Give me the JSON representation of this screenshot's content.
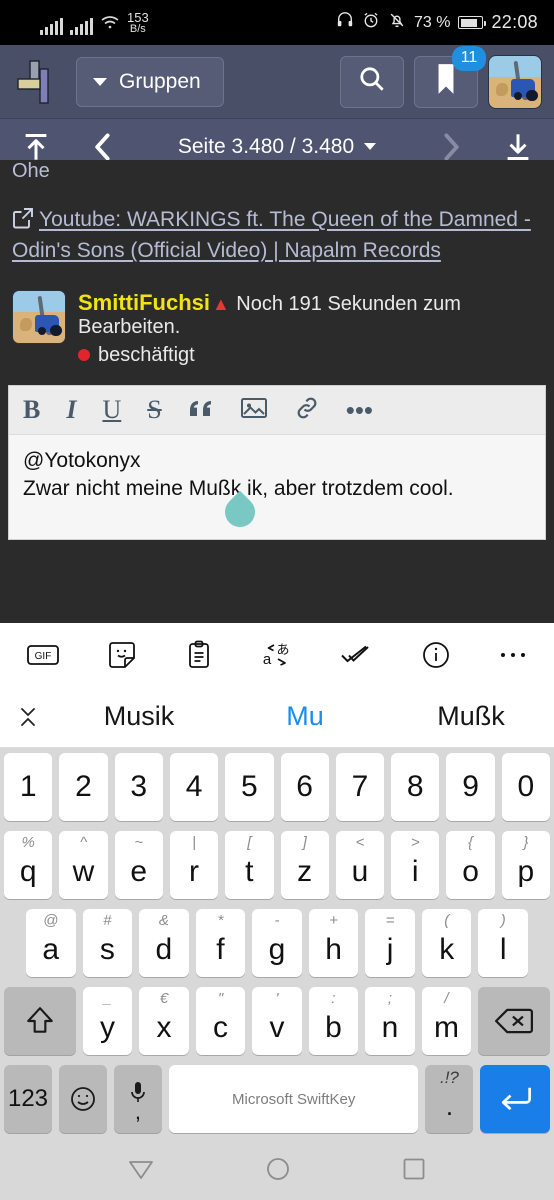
{
  "status_bar": {
    "data_rate_value": "153",
    "data_rate_unit": "B/s",
    "battery_percent": "73 %",
    "clock": "22:08",
    "icons": [
      "signal-bars-icon",
      "signal-bars-icon",
      "wifi-icon",
      "headphones-icon",
      "alarm-icon",
      "mute-bell-icon",
      "battery-icon"
    ]
  },
  "header": {
    "logo": "forum-logo-icon",
    "groups_label": "Gruppen",
    "search_icon": "search-icon",
    "bookmark_icon": "bookmark-icon",
    "bookmark_badge": "11",
    "avatar": "user-avatar-tractor"
  },
  "pagination": {
    "scroll_top_icon": "scroll-to-top-icon",
    "prev_icon": "chevron-left-icon",
    "page_label": "Seite 3.480 / 3.480",
    "dropdown_icon": "chevron-down-icon",
    "next_icon": "chevron-right-icon",
    "scroll_bottom_icon": "scroll-to-bottom-icon"
  },
  "thread": {
    "clipped_text": "Ohe",
    "link_icon": "external-link-icon",
    "link_text": "Youtube: WARKINGS ft. The Queen of the Damned - Odin's Sons (Official Video) | Napalm Records",
    "post": {
      "username": "SmittiFuchsi",
      "warning_icon": "warning-triangle-icon",
      "edit_notice": "Noch 191 Sekunden zum Bearbeiten.",
      "presence_label": "beschäftigt",
      "presence_color": "#e0262b",
      "username_color": "#f2e313"
    }
  },
  "editor": {
    "toolbar": [
      {
        "name": "bold-button",
        "label": "B"
      },
      {
        "name": "italic-button",
        "label": "I"
      },
      {
        "name": "underline-button",
        "label": "U"
      },
      {
        "name": "strikethrough-button",
        "label": "S"
      },
      {
        "name": "quote-button",
        "label": "”"
      },
      {
        "name": "image-button",
        "label": "image-icon"
      },
      {
        "name": "link-button",
        "label": "link-icon"
      },
      {
        "name": "more-button",
        "label": "•••"
      }
    ],
    "line1": "@Yotokonyx",
    "line2": "Zwar nicht meine Mußk ik, aber trotzdem cool.",
    "cursor_handle_color": "#79c8c3"
  },
  "keyboard": {
    "toolbar_icons": [
      "gif-icon",
      "sticker-icon",
      "clipboard-icon",
      "translate-icon",
      "spellcheck-icon",
      "info-icon",
      "more-icon"
    ],
    "gif_label": "GIF",
    "close_icon": "close-predictions-icon",
    "predictions": [
      {
        "text": "Musik",
        "active": false
      },
      {
        "text": "Mu",
        "active": true
      },
      {
        "text": "Mußk",
        "active": false
      }
    ],
    "prediction_active_color": "#1a8cf0",
    "row_numbers": [
      "1",
      "2",
      "3",
      "4",
      "5",
      "6",
      "7",
      "8",
      "9",
      "0"
    ],
    "row1": [
      {
        "key": "q",
        "sub": "%"
      },
      {
        "key": "w",
        "sub": "^"
      },
      {
        "key": "e",
        "sub": "~"
      },
      {
        "key": "r",
        "sub": "|"
      },
      {
        "key": "t",
        "sub": "["
      },
      {
        "key": "z",
        "sub": "]"
      },
      {
        "key": "u",
        "sub": "<"
      },
      {
        "key": "i",
        "sub": ">"
      },
      {
        "key": "o",
        "sub": "{"
      },
      {
        "key": "p",
        "sub": "}"
      }
    ],
    "row2": [
      {
        "key": "a",
        "sub": "@"
      },
      {
        "key": "s",
        "sub": "#"
      },
      {
        "key": "d",
        "sub": "&"
      },
      {
        "key": "f",
        "sub": "*"
      },
      {
        "key": "g",
        "sub": "-"
      },
      {
        "key": "h",
        "sub": "+"
      },
      {
        "key": "j",
        "sub": "="
      },
      {
        "key": "k",
        "sub": "("
      },
      {
        "key": "l",
        "sub": ")"
      }
    ],
    "row3": [
      {
        "key": "y",
        "sub": "_"
      },
      {
        "key": "x",
        "sub": "€"
      },
      {
        "key": "c",
        "sub": "\""
      },
      {
        "key": "v",
        "sub": "'"
      },
      {
        "key": "b",
        "sub": ":"
      },
      {
        "key": "n",
        "sub": ";"
      },
      {
        "key": "m",
        "sub": "/"
      }
    ],
    "shift_icon": "shift-icon",
    "backspace_icon": "backspace-icon",
    "numbers_key": "123",
    "emoji_icon": "emoji-icon",
    "mic_icon": "microphone-icon",
    "comma_key": ",",
    "space_label": "Microsoft SwiftKey",
    "punct_sub": ".!?",
    "punct_key": ".",
    "enter_icon": "enter-icon",
    "enter_color": "#1a7ee8"
  },
  "nav_bar": {
    "back_icon": "back-triangle-icon",
    "home_icon": "home-circle-icon",
    "recents_icon": "recents-square-icon"
  }
}
